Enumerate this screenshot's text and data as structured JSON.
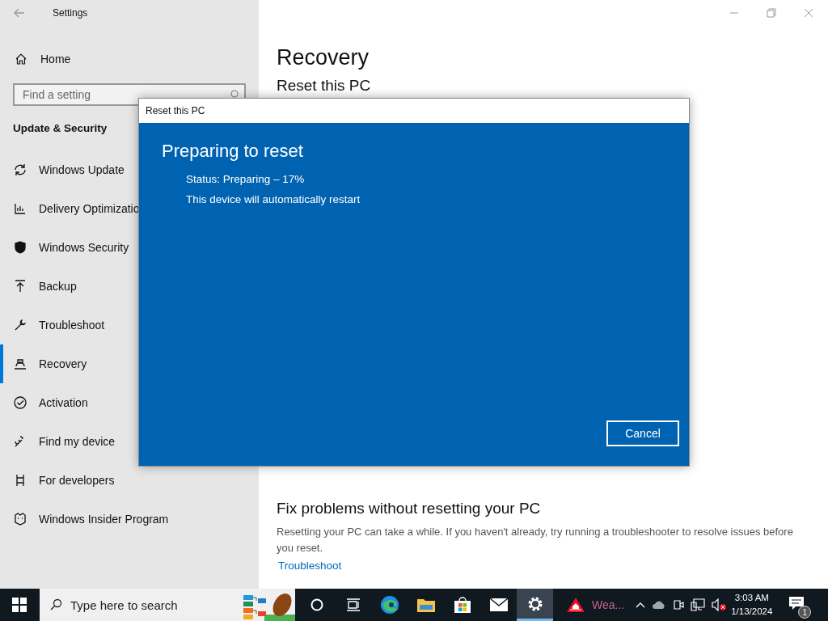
{
  "window": {
    "title": "Settings"
  },
  "sidebar": {
    "home": "Home",
    "search": {
      "placeholder": "Find a setting"
    },
    "section": "Update & Security",
    "items": [
      {
        "label": "Windows Update",
        "selected": false
      },
      {
        "label": "Delivery Optimizatio",
        "selected": false
      },
      {
        "label": "Windows Security",
        "selected": false
      },
      {
        "label": "Backup",
        "selected": false
      },
      {
        "label": "Troubleshoot",
        "selected": false
      },
      {
        "label": "Recovery",
        "selected": true
      },
      {
        "label": "Activation",
        "selected": false
      },
      {
        "label": "Find my device",
        "selected": false
      },
      {
        "label": "For developers",
        "selected": false
      },
      {
        "label": "Windows Insider Program",
        "selected": false
      }
    ]
  },
  "main": {
    "title": "Recovery",
    "section_heading": "Reset this PC",
    "fix": {
      "title": "Fix problems without resetting your PC",
      "text": "Resetting your PC can take a while. If you haven't already, try running a troubleshooter to resolve issues before you reset.",
      "link": "Troubleshoot"
    }
  },
  "dialog": {
    "title": "Reset this PC",
    "heading": "Preparing to reset",
    "lines": [
      "Status: Preparing – 17%",
      "This device will automatically restart"
    ],
    "button": "Cancel"
  },
  "taskbar": {
    "search": {
      "placeholder": "Type here to search"
    },
    "apps": [
      {
        "kind": "cortana",
        "active": false
      },
      {
        "kind": "taskview",
        "active": false
      },
      {
        "kind": "edge",
        "active": false
      },
      {
        "kind": "explorer",
        "active": false
      },
      {
        "kind": "store",
        "active": false
      },
      {
        "kind": "mail",
        "active": false
      },
      {
        "kind": "settings",
        "active": true
      }
    ],
    "weather": {
      "label": "Wea..."
    },
    "clock": {
      "time": "3:03 AM",
      "date": "1/13/2024"
    },
    "notifications": {
      "count": "1"
    }
  }
}
